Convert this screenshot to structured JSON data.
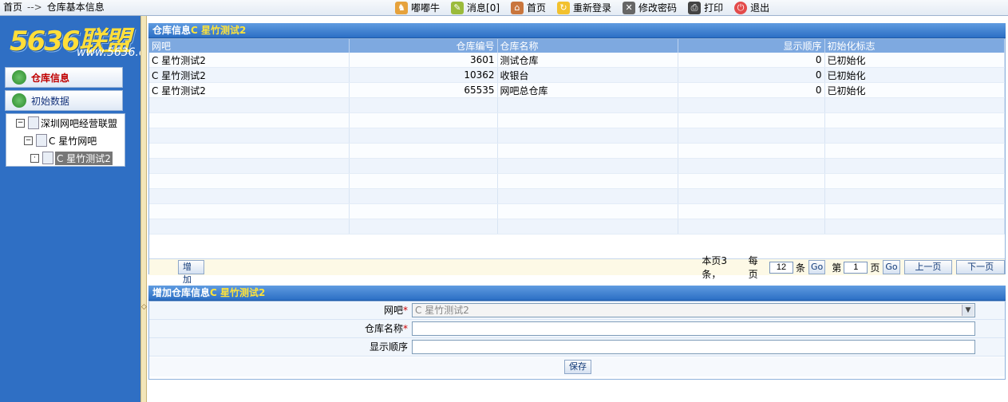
{
  "breadcrumb": {
    "home": "首页",
    "arrow": "-->",
    "current": "仓库基本信息"
  },
  "toolbar": [
    {
      "icon": "cow-icon",
      "label": "嘟嘟牛"
    },
    {
      "icon": "message-icon",
      "label": "消息[0]"
    },
    {
      "icon": "home-icon",
      "label": "首页"
    },
    {
      "icon": "relogin-icon",
      "label": "重新登录"
    },
    {
      "icon": "password-icon",
      "label": "修改密码"
    },
    {
      "icon": "printer-icon",
      "label": "打印"
    },
    {
      "icon": "exit-icon",
      "label": "退出"
    }
  ],
  "logo": {
    "text": "5636联盟",
    "sub": "www.5636.com"
  },
  "sidebar": {
    "items": [
      {
        "label": "仓库信息"
      },
      {
        "label": "初始数据"
      }
    ],
    "tree": {
      "root": "深圳网吧经营联盟",
      "child": "C 星竹网吧",
      "leaf": "C 星竹测试2",
      "collapse_sign": "−",
      "leaf_sign": "·"
    }
  },
  "list_panel": {
    "title_prefix": "仓库信息",
    "title_highlight": "C 星竹测试2",
    "columns": [
      "网吧",
      "仓库编号",
      "仓库名称",
      "显示顺序",
      "初始化标志"
    ],
    "rows": [
      [
        "C 星竹测试2",
        "3601",
        "测试仓库",
        "0",
        "已初始化"
      ],
      [
        "C 星竹测试2",
        "10362",
        "收银台",
        "0",
        "已初始化"
      ],
      [
        "C 星竹测试2",
        "65535",
        "网吧总仓库",
        "0",
        "已初始化"
      ]
    ],
    "empty_rows": 9,
    "add_button": "增加",
    "pager": {
      "summary": "本页3条，",
      "per_page_label": "每页",
      "per_page_value": "12",
      "unit_items": "条",
      "go_label": "Go",
      "page_prefix": "第",
      "page_value": "1",
      "page_unit": "页",
      "prev": "上一页",
      "next": "下一页"
    }
  },
  "form_panel": {
    "title_prefix": "增加仓库信息",
    "title_highlight": "C 星竹测试2",
    "fields": [
      {
        "label": "网吧",
        "required_mark": "*",
        "value": "C 星竹测试2",
        "dropdown_arrow": "▼"
      },
      {
        "label": "仓库名称",
        "required_mark": "*",
        "value": ""
      },
      {
        "label": "显示顺序",
        "value": ""
      }
    ],
    "save_button": "保存"
  },
  "colors": {
    "sidebar": "#2f6fc4",
    "header_grad_top": "#5f9be0",
    "highlight": "#ffe33a",
    "accent_red": "#c00000"
  }
}
